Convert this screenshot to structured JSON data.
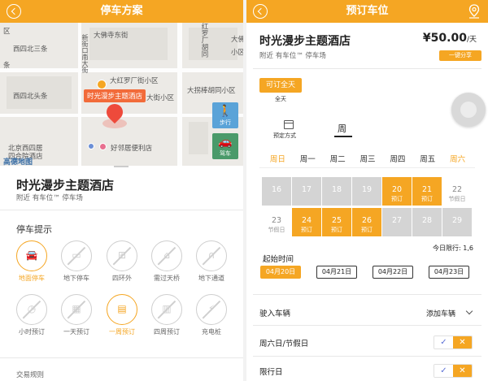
{
  "left": {
    "header_title": "停车方案",
    "map": {
      "labels": [
        "大佛寺东街",
        "西四北三条",
        "新街口南大街",
        "西四北头条",
        "大红罗厂街小区",
        "大佛寺东街",
        "大拐棒胡同小区",
        "大街小区",
        "北京西四居",
        "四合院酒店",
        "好邻居便利店",
        "红罗厂胡同",
        "大佛寺",
        "小区",
        "区",
        "条",
        "步行",
        "驾车"
      ],
      "hotel_label": "时光漫步主题酒店",
      "walk_label": "步行",
      "drive_label": "驾车",
      "attribution": "高德地图"
    },
    "venue_name": "时光漫步主题酒店",
    "venue_sub": "附近 有车位™ 停车场",
    "section_title": "停车提示",
    "options": [
      {
        "label": "地面停车",
        "active": true
      },
      {
        "label": "地下停车",
        "active": false
      },
      {
        "label": "四环外",
        "active": false
      },
      {
        "label": "需过天桥",
        "active": false
      },
      {
        "label": "地下通道",
        "active": false
      },
      {
        "label": "小时预订",
        "active": false
      },
      {
        "label": "一天预订",
        "active": false
      },
      {
        "label": "一周预订",
        "active": true
      },
      {
        "label": "四周预订",
        "active": false
      },
      {
        "label": "充电桩",
        "active": false
      }
    ],
    "rules_label": "交易规则"
  },
  "right": {
    "header_title": "预订车位",
    "venue_name": "时光漫步主题酒店",
    "venue_sub": "附近 有车位™ 停车场",
    "price": "¥50.00",
    "price_unit": "/天",
    "share_label": "一键分享",
    "allday_label": "可订全天",
    "allday_caption": "全天",
    "mode_caption": "预定方式",
    "week_tab": "周",
    "weekdays": [
      "周日",
      "周一",
      "周二",
      "周三",
      "周四",
      "周五",
      "周六"
    ],
    "calendar": [
      {
        "n": "16",
        "t": "",
        "s": "grey"
      },
      {
        "n": "17",
        "t": "",
        "s": "grey"
      },
      {
        "n": "18",
        "t": "",
        "s": "grey"
      },
      {
        "n": "19",
        "t": "",
        "s": "grey"
      },
      {
        "n": "20",
        "t": "预订",
        "s": "sel"
      },
      {
        "n": "21",
        "t": "预订",
        "s": "sel"
      },
      {
        "n": "22",
        "t": "节假日",
        "s": "white"
      },
      {
        "n": "23",
        "t": "节假日",
        "s": "white"
      },
      {
        "n": "24",
        "t": "预订",
        "s": "sel"
      },
      {
        "n": "25",
        "t": "预订",
        "s": "sel"
      },
      {
        "n": "26",
        "t": "预订",
        "s": "sel"
      },
      {
        "n": "27",
        "t": "",
        "s": "grey"
      },
      {
        "n": "28",
        "t": "",
        "s": "grey"
      },
      {
        "n": "29",
        "t": "",
        "s": "grey"
      }
    ],
    "today_limit": "今日限行: 1,6",
    "start_time_label": "起始时间",
    "dates": [
      "04月20日",
      "04月21日",
      "04月22日",
      "04月23日"
    ],
    "vehicle_label": "驶入车辆",
    "add_vehicle_label": "添加车辆",
    "weekend_label": "周六日/节假日",
    "restrict_label": "限行日",
    "toggle_yes": "✓",
    "toggle_no": "✕"
  }
}
